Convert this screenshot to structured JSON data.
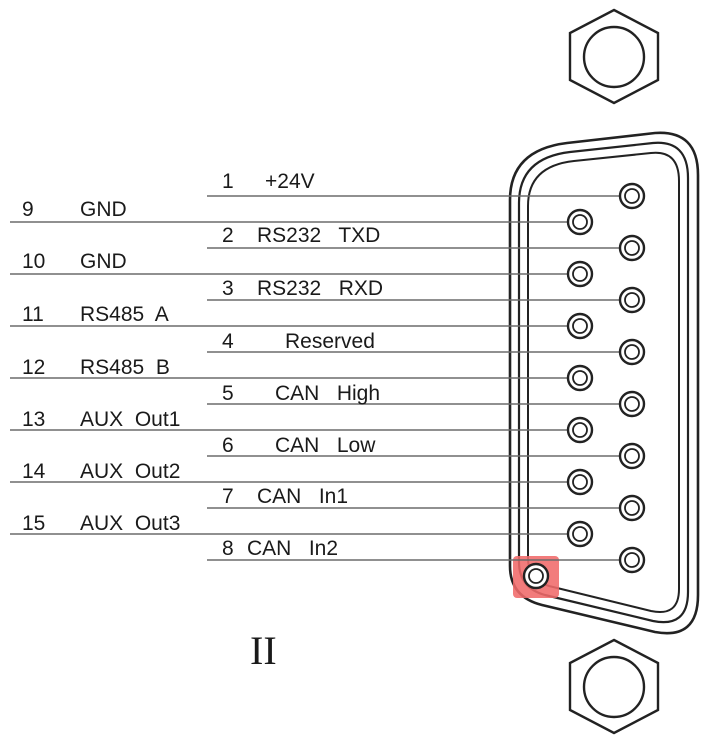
{
  "figure_label": "II",
  "pins_right": [
    {
      "num": "1",
      "signal": "+24V"
    },
    {
      "num": "2",
      "signal": "RS232   TXD"
    },
    {
      "num": "3",
      "signal": "RS232   RXD"
    },
    {
      "num": "4",
      "signal": "Reserved"
    },
    {
      "num": "5",
      "signal": "CAN   High"
    },
    {
      "num": "6",
      "signal": "CAN   Low"
    },
    {
      "num": "7",
      "signal": "CAN   In1"
    },
    {
      "num": "8",
      "signal": "CAN   In2"
    }
  ],
  "pins_left": [
    {
      "num": "9",
      "signal": "GND"
    },
    {
      "num": "10",
      "signal": "GND"
    },
    {
      "num": "11",
      "signal": "RS485  A"
    },
    {
      "num": "12",
      "signal": "RS485  B"
    },
    {
      "num": "13",
      "signal": "AUX  Out1"
    },
    {
      "num": "14",
      "signal": "AUX  Out2"
    },
    {
      "num": "15",
      "signal": "AUX  Out3"
    }
  ],
  "highlight_color": "#f06a6a"
}
